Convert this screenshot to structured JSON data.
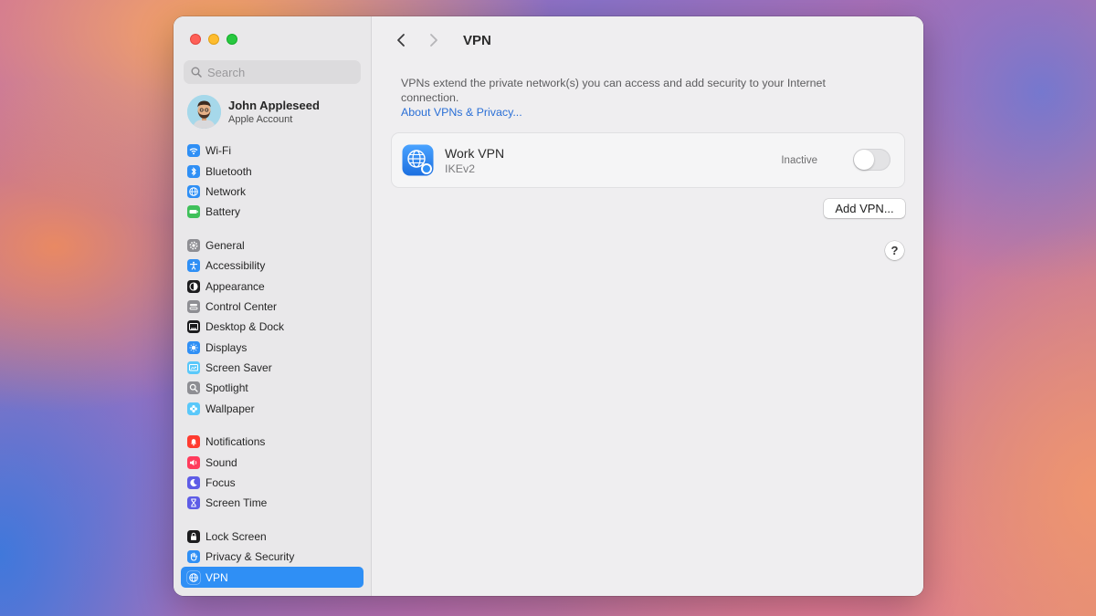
{
  "window": {
    "title": "VPN"
  },
  "sidebar": {
    "search_placeholder": "Search",
    "account": {
      "name": "John Appleseed",
      "subtitle": "Apple Account"
    },
    "groups": [
      [
        {
          "id": "wifi",
          "label": "Wi-Fi",
          "icon": "wifi-icon",
          "color": "#2f8ff5"
        },
        {
          "id": "bluetooth",
          "label": "Bluetooth",
          "icon": "bluetooth-icon",
          "color": "#2f8ff5"
        },
        {
          "id": "network",
          "label": "Network",
          "icon": "globe-icon",
          "color": "#2f8ff5"
        },
        {
          "id": "battery",
          "label": "Battery",
          "icon": "battery-icon",
          "color": "#3fc05a"
        }
      ],
      [
        {
          "id": "general",
          "label": "General",
          "icon": "gear-icon",
          "color": "#8e8e93"
        },
        {
          "id": "accessibility",
          "label": "Accessibility",
          "icon": "accessibility-icon",
          "color": "#2f8ff5"
        },
        {
          "id": "appearance",
          "label": "Appearance",
          "icon": "appearance-icon",
          "color": "#1c1c1e"
        },
        {
          "id": "control-center",
          "label": "Control Center",
          "icon": "control-center-icon",
          "color": "#8e8e93"
        },
        {
          "id": "desktop-dock",
          "label": "Desktop & Dock",
          "icon": "dock-icon",
          "color": "#1c1c1e"
        },
        {
          "id": "displays",
          "label": "Displays",
          "icon": "sun-icon",
          "color": "#2f8ff5"
        },
        {
          "id": "screen-saver",
          "label": "Screen Saver",
          "icon": "screen-saver-icon",
          "color": "#5ac8fa"
        },
        {
          "id": "spotlight",
          "label": "Spotlight",
          "icon": "magnifier-icon",
          "color": "#8e8e93"
        },
        {
          "id": "wallpaper",
          "label": "Wallpaper",
          "icon": "flower-icon",
          "color": "#5ac8fa"
        }
      ],
      [
        {
          "id": "notifications",
          "label": "Notifications",
          "icon": "bell-icon",
          "color": "#ff3b30"
        },
        {
          "id": "sound",
          "label": "Sound",
          "icon": "speaker-icon",
          "color": "#ff3b5c"
        },
        {
          "id": "focus",
          "label": "Focus",
          "icon": "moon-icon",
          "color": "#5e5ce6"
        },
        {
          "id": "screen-time",
          "label": "Screen Time",
          "icon": "hourglass-icon",
          "color": "#5e5ce6"
        }
      ],
      [
        {
          "id": "lock-screen",
          "label": "Lock Screen",
          "icon": "lock-icon",
          "color": "#1c1c1e"
        },
        {
          "id": "privacy-security",
          "label": "Privacy & Security",
          "icon": "hand-icon",
          "color": "#2f8ff5"
        },
        {
          "id": "vpn",
          "label": "VPN",
          "icon": "globe-icon",
          "color": "#2f8ff5",
          "selected": true
        }
      ]
    ]
  },
  "main": {
    "description": "VPNs extend the private network(s) you can access and add security to your Internet connection.",
    "link": "About VPNs & Privacy...",
    "vpn": {
      "name": "Work VPN",
      "type": "IKEv2",
      "status": "Inactive",
      "enabled": false
    },
    "add_button": "Add VPN...",
    "help_button": "?"
  }
}
